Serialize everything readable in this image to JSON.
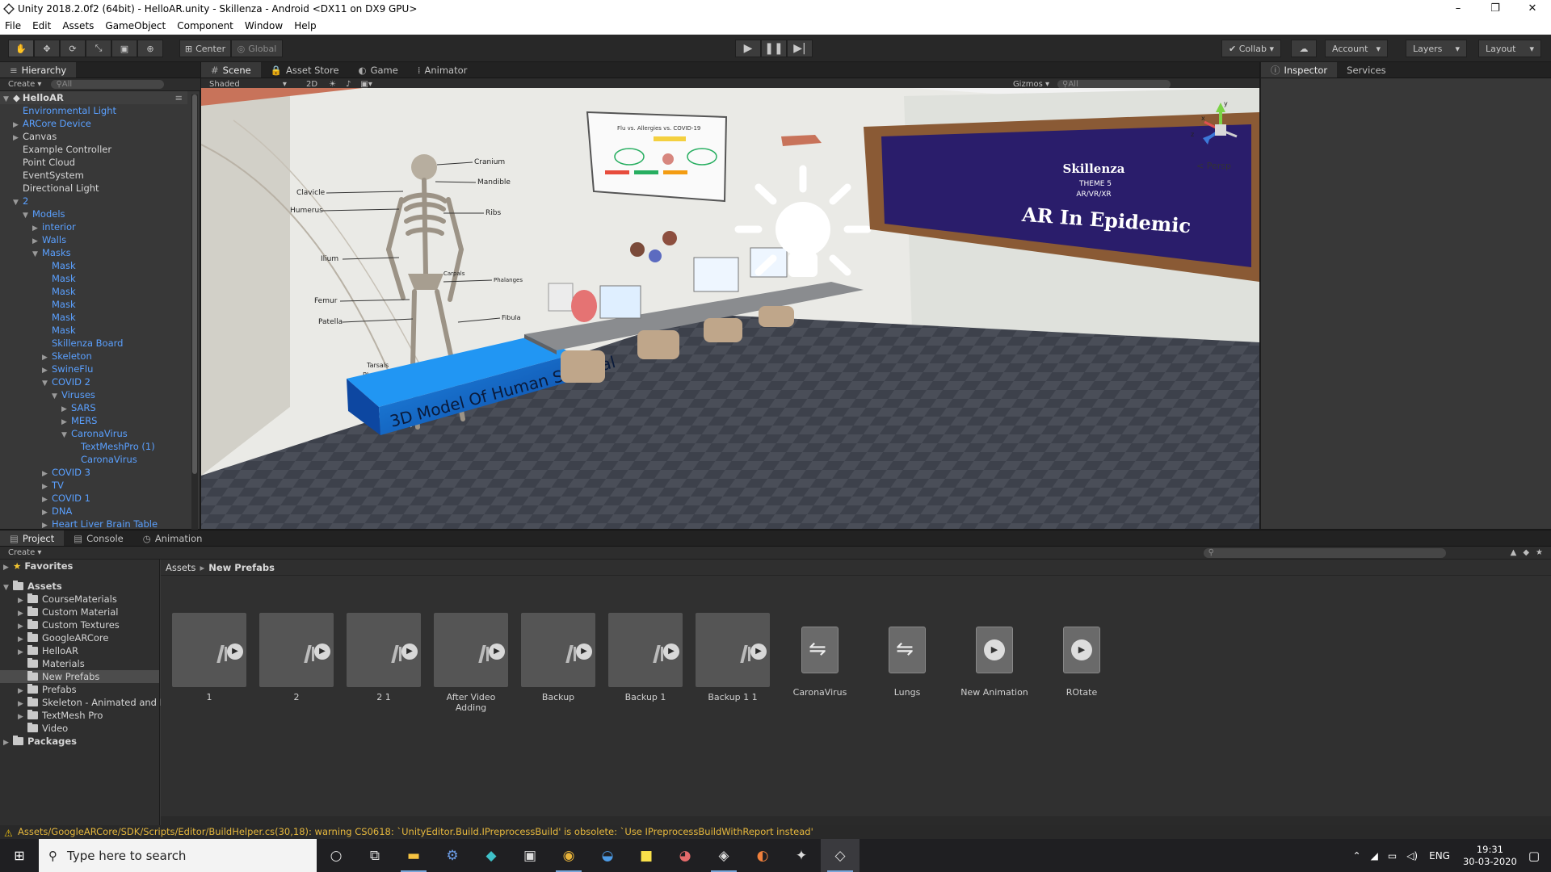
{
  "window": {
    "title": "Unity 2018.2.0f2 (64bit) - HelloAR.unity - Skillenza - Android <DX11 on DX9 GPU>",
    "controls": [
      "–",
      "❐",
      "✕"
    ]
  },
  "menu": [
    "File",
    "Edit",
    "Assets",
    "GameObject",
    "Component",
    "Window",
    "Help"
  ],
  "toolbar": {
    "pivot": "Center",
    "space": "Global",
    "collab": "Collab",
    "account": "Account",
    "layers": "Layers",
    "layout": "Layout"
  },
  "hierarchy": {
    "tab": "Hierarchy",
    "create": "Create",
    "search_placeholder": "All",
    "scene_name": "HelloAR",
    "items": [
      {
        "label": "Environmental Light",
        "depth": 1,
        "arrow": "",
        "color": "blue"
      },
      {
        "label": "ARCore Device",
        "depth": 1,
        "arrow": "▶",
        "color": "blue"
      },
      {
        "label": "Canvas",
        "depth": 1,
        "arrow": "▶",
        "color": "white"
      },
      {
        "label": "Example Controller",
        "depth": 1,
        "arrow": "",
        "color": "white"
      },
      {
        "label": "Point Cloud",
        "depth": 1,
        "arrow": "",
        "color": "white"
      },
      {
        "label": "EventSystem",
        "depth": 1,
        "arrow": "",
        "color": "white"
      },
      {
        "label": "Directional Light",
        "depth": 1,
        "arrow": "",
        "color": "white"
      },
      {
        "label": "2",
        "depth": 1,
        "arrow": "▼",
        "color": "blue"
      },
      {
        "label": "Models",
        "depth": 2,
        "arrow": "▼",
        "color": "blue"
      },
      {
        "label": "interior",
        "depth": 3,
        "arrow": "▶",
        "color": "blue"
      },
      {
        "label": "Walls",
        "depth": 3,
        "arrow": "▶",
        "color": "blue"
      },
      {
        "label": "Masks",
        "depth": 3,
        "arrow": "▼",
        "color": "blue"
      },
      {
        "label": "Mask",
        "depth": 4,
        "arrow": "",
        "color": "blue"
      },
      {
        "label": "Mask",
        "depth": 4,
        "arrow": "",
        "color": "blue"
      },
      {
        "label": "Mask",
        "depth": 4,
        "arrow": "",
        "color": "blue"
      },
      {
        "label": "Mask",
        "depth": 4,
        "arrow": "",
        "color": "blue"
      },
      {
        "label": "Mask",
        "depth": 4,
        "arrow": "",
        "color": "blue"
      },
      {
        "label": "Mask",
        "depth": 4,
        "arrow": "",
        "color": "blue"
      },
      {
        "label": "Skillenza Board",
        "depth": 4,
        "arrow": "",
        "color": "blue"
      },
      {
        "label": "Skeleton",
        "depth": 4,
        "arrow": "▶",
        "color": "blue"
      },
      {
        "label": "SwineFlu",
        "depth": 4,
        "arrow": "▶",
        "color": "blue"
      },
      {
        "label": "COVID 2",
        "depth": 4,
        "arrow": "▼",
        "color": "blue"
      },
      {
        "label": "Viruses",
        "depth": 5,
        "arrow": "▼",
        "color": "blue"
      },
      {
        "label": "SARS",
        "depth": 6,
        "arrow": "▶",
        "color": "blue"
      },
      {
        "label": "MERS",
        "depth": 6,
        "arrow": "▶",
        "color": "blue"
      },
      {
        "label": "CaronaVirus",
        "depth": 6,
        "arrow": "▼",
        "color": "blue"
      },
      {
        "label": "TextMeshPro (1)",
        "depth": 7,
        "arrow": "",
        "color": "blue"
      },
      {
        "label": "CaronaVirus",
        "depth": 7,
        "arrow": "",
        "color": "blue"
      },
      {
        "label": "COVID 3",
        "depth": 4,
        "arrow": "▶",
        "color": "blue"
      },
      {
        "label": "TV",
        "depth": 4,
        "arrow": "▶",
        "color": "blue"
      },
      {
        "label": "COVID 1",
        "depth": 4,
        "arrow": "▶",
        "color": "blue"
      },
      {
        "label": "DNA",
        "depth": 4,
        "arrow": "▶",
        "color": "blue"
      },
      {
        "label": "Heart Liver Brain Table",
        "depth": 4,
        "arrow": "▶",
        "color": "blue"
      }
    ]
  },
  "scene_tabs": [
    {
      "label": "Scene",
      "glyph": "#",
      "active": true
    },
    {
      "label": "Asset Store",
      "glyph": "🔒",
      "active": false
    },
    {
      "label": "Game",
      "glyph": "◐",
      "active": false
    },
    {
      "label": "Animator",
      "glyph": "⁞",
      "active": false
    }
  ],
  "scene_toolbar": {
    "shading": "Shaded",
    "mode_2d": "2D",
    "gizmos": "Gizmos",
    "search_placeholder": "All",
    "persp": "< Persp"
  },
  "viewport": {
    "skeleton_labels": [
      "Cranium",
      "Mandible",
      "Clavicle",
      "Humerus",
      "Ribs",
      "Ilium",
      "Carpals",
      "Phalanges",
      "Femur",
      "Patella",
      "Fibula",
      "Tarsals",
      "Phalanges"
    ],
    "plinth_text": "3D Model Of Human Skeletal",
    "poster_title": "Flu vs. Allergies vs. COVID-19",
    "board": {
      "brand": "Skillenza",
      "theme": "THEME 5",
      "sub": "AR/VR/XR",
      "headline": "AR In Epidemic"
    },
    "gizmo_axes": [
      "x",
      "y",
      "z"
    ]
  },
  "inspector": {
    "tabs": [
      {
        "label": "Inspector",
        "glyph": "ⓘ",
        "active": true
      },
      {
        "label": "Services",
        "glyph": "",
        "active": false
      }
    ]
  },
  "project": {
    "tabs": [
      {
        "label": "Project",
        "glyph": "▤",
        "active": true
      },
      {
        "label": "Console",
        "glyph": "▤",
        "active": false
      },
      {
        "label": "Animation",
        "glyph": "◷",
        "active": false
      }
    ],
    "create": "Create",
    "tree": [
      {
        "label": "Favorites",
        "depth": 0,
        "arrow": "▶",
        "bold": true,
        "icon": "star"
      },
      {
        "label": "Assets",
        "depth": 0,
        "arrow": "▼",
        "bold": true,
        "icon": "folder"
      },
      {
        "label": "CourseMaterials",
        "depth": 1,
        "arrow": "▶",
        "bold": false,
        "icon": "folder"
      },
      {
        "label": "Custom Material",
        "depth": 1,
        "arrow": "▶",
        "bold": false,
        "icon": "folder"
      },
      {
        "label": "Custom Textures",
        "depth": 1,
        "arrow": "▶",
        "bold": false,
        "icon": "folder"
      },
      {
        "label": "GoogleARCore",
        "depth": 1,
        "arrow": "▶",
        "bold": false,
        "icon": "folder"
      },
      {
        "label": "HelloAR",
        "depth": 1,
        "arrow": "▶",
        "bold": false,
        "icon": "folder"
      },
      {
        "label": "Materials",
        "depth": 1,
        "arrow": "",
        "bold": false,
        "icon": "folder"
      },
      {
        "label": "New Prefabs",
        "depth": 1,
        "arrow": "",
        "bold": false,
        "icon": "folder",
        "selected": true
      },
      {
        "label": "Prefabs",
        "depth": 1,
        "arrow": "▶",
        "bold": false,
        "icon": "folder"
      },
      {
        "label": "Skeleton - Animated and L",
        "depth": 1,
        "arrow": "▶",
        "bold": false,
        "icon": "folder"
      },
      {
        "label": "TextMesh Pro",
        "depth": 1,
        "arrow": "▶",
        "bold": false,
        "icon": "folder"
      },
      {
        "label": "Video",
        "depth": 1,
        "arrow": "",
        "bold": false,
        "icon": "folder"
      },
      {
        "label": "Packages",
        "depth": 0,
        "arrow": "▶",
        "bold": true,
        "icon": "folder"
      }
    ],
    "breadcrumb": [
      "Assets",
      "New Prefabs"
    ],
    "assets": [
      {
        "label": "1",
        "kind": "model"
      },
      {
        "label": "2",
        "kind": "model"
      },
      {
        "label": "2 1",
        "kind": "model"
      },
      {
        "label": "After Video Adding",
        "kind": "model"
      },
      {
        "label": "Backup",
        "kind": "model"
      },
      {
        "label": "Backup 1",
        "kind": "model"
      },
      {
        "label": "Backup 1 1",
        "kind": "model"
      },
      {
        "label": "CaronaVirus",
        "kind": "controller"
      },
      {
        "label": "Lungs",
        "kind": "controller"
      },
      {
        "label": "New Animation",
        "kind": "clip"
      },
      {
        "label": "ROtate",
        "kind": "clip"
      }
    ]
  },
  "status": {
    "message": "Assets/GoogleARCore/SDK/Scripts/Editor/BuildHelper.cs(30,18): warning CS0618: `UnityEditor.Build.IPreprocessBuild' is obsolete: `Use IPreprocessBuildWithReport instead'"
  },
  "taskbar": {
    "search_placeholder": "Type here to search",
    "language": "ENG",
    "time": "19:31",
    "date": "30-03-2020"
  },
  "colors": {
    "prefab_blue": "#5aa0ff",
    "panel_bg": "#383838",
    "warning": "#e6b83d"
  }
}
